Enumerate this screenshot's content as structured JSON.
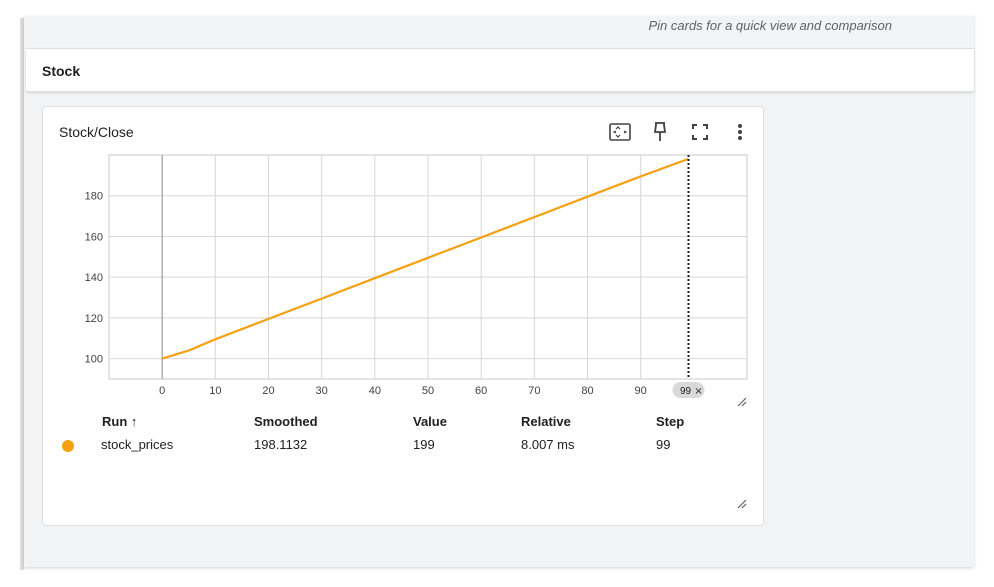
{
  "pin_hint": "Pin cards for a quick view and comparison",
  "group": {
    "title": "Stock"
  },
  "card": {
    "title": "Stock/Close",
    "icons": [
      "fit-domain-icon",
      "pin-icon",
      "fullscreen-icon",
      "more-vert-icon"
    ]
  },
  "chart_data": {
    "type": "line",
    "title": "",
    "xlabel": "",
    "ylabel": "",
    "x_ticks": [
      0,
      10,
      20,
      30,
      40,
      50,
      60,
      70,
      80,
      90
    ],
    "y_ticks": [
      100,
      120,
      140,
      160,
      180
    ],
    "xlim": [
      -10,
      110
    ],
    "ylim": [
      90,
      200
    ],
    "grid": true,
    "series": [
      {
        "name": "stock_prices",
        "color": "#f5a00f",
        "x": [
          0,
          5,
          10,
          20,
          30,
          40,
          50,
          60,
          70,
          80,
          90,
          99
        ],
        "y": [
          100,
          104,
          109.5,
          119.5,
          129.5,
          139.5,
          149.5,
          159.5,
          169.5,
          179.5,
          189.5,
          198.1
        ]
      }
    ],
    "cursor_step": 99,
    "cursor_label": "99"
  },
  "table": {
    "headers": {
      "run": "Run",
      "smoothed": "Smoothed",
      "value": "Value",
      "relative": "Relative",
      "step": "Step"
    },
    "sort_arrow": "↑",
    "rows": [
      {
        "color": "#f5a00f",
        "run": "stock_prices",
        "smoothed": "198.1132",
        "value": "199",
        "relative": "8.007 ms",
        "step": "99"
      }
    ]
  }
}
